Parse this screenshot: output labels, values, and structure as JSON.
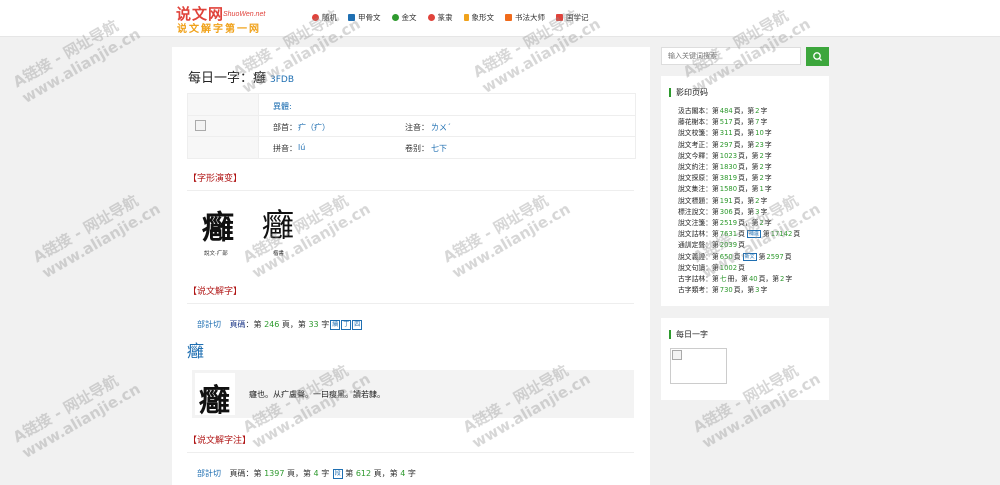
{
  "logo": {
    "main": "说文网",
    "domain": "ShuoWen.net",
    "sub": "说文解字第一网"
  },
  "nav": [
    {
      "label": "随机",
      "icon": "plus-circle-icon",
      "color": "#e0433b"
    },
    {
      "label": "甲骨文",
      "icon": "bone-icon",
      "color": "#1f6fb2"
    },
    {
      "label": "金文",
      "icon": "gear-icon",
      "color": "#2e9a2e"
    },
    {
      "label": "篆隶",
      "icon": "gear-icon",
      "color": "#e0433b"
    },
    {
      "label": "象形文",
      "icon": "brush-icon",
      "color": "#f0a21b"
    },
    {
      "label": "书法大师",
      "icon": "grid-icon",
      "color": "#f06b1b"
    },
    {
      "label": "国学记",
      "icon": "grid-icon",
      "color": "#e0433b"
    }
  ],
  "entry": {
    "heading": "每日一字：",
    "char": "癰",
    "code": "3FDB",
    "yiti_label": "異體:",
    "radical_label": "部首：",
    "radical_value": "疒（疒）",
    "zhuyin_label": "注音：",
    "zhuyin_value": "ㄌㄨˊ",
    "pinyin_label": "拼音：",
    "pinyin_value": "lú",
    "volume_label": "卷别：",
    "volume_value": "七下"
  },
  "sections": {
    "evolution": "【字形演变】",
    "shuowen": "【说文解字】",
    "shuowen_note": "【说文解字注】"
  },
  "evolution_captions": [
    "說文·疒部",
    "楷書"
  ],
  "shuowen_line": {
    "fanqie": "部計切",
    "page_label": "頁碼",
    "text_a": "：第",
    "page": "246",
    "text_b": "頁，第",
    "index": "33",
    "text_c": "字",
    "boxes": [
      "續",
      "丁",
      "四"
    ]
  },
  "def_char": "癰",
  "definition": "癰也。从疒盧聲。一曰瘦黑。讀若隸。",
  "note_line": {
    "fanqie": "部計切",
    "page_label": "頁碼",
    "text_a": "：第",
    "page": "1397",
    "text_b": "頁，第",
    "index": "4",
    "text_c": "字",
    "box": "段",
    "text_d": "第",
    "page2": "612",
    "text_e": "頁，第",
    "index2": "4",
    "text_f": "字"
  },
  "search": {
    "placeholder": "输入关键词搜索"
  },
  "page_panel": {
    "title": "影印页码",
    "rows": [
      {
        "name": "汲古閣本",
        "a": "第",
        "p1": "484",
        "b": "頁，第",
        "p2": "2",
        "c": "字"
      },
      {
        "name": "藤花榭本",
        "a": "第",
        "p1": "517",
        "b": "頁，第",
        "p2": "7",
        "c": "字"
      },
      {
        "name": "說文校箋",
        "a": "第",
        "p1": "311",
        "b": "頁，第",
        "p2": "10",
        "c": "字"
      },
      {
        "name": "說文考正",
        "a": "第",
        "p1": "297",
        "b": "頁，第",
        "p2": "23",
        "c": "字"
      },
      {
        "name": "說文今釋",
        "a": "第",
        "p1": "1023",
        "b": "頁，第",
        "p2": "2",
        "c": "字"
      },
      {
        "name": "說文約注",
        "a": "第",
        "p1": "1830",
        "b": "頁，第",
        "p2": "2",
        "c": "字"
      },
      {
        "name": "說文探原",
        "a": "第",
        "p1": "3819",
        "b": "頁，第",
        "p2": "2",
        "c": "字"
      },
      {
        "name": "說文集注",
        "a": "第",
        "p1": "1580",
        "b": "頁，第",
        "p2": "1",
        "c": "字"
      },
      {
        "name": "說文標題",
        "a": "第",
        "p1": "191",
        "b": "頁，第",
        "p2": "2",
        "c": "字"
      },
      {
        "name": "標注說文",
        "a": "第",
        "p1": "306",
        "b": "頁，第",
        "p2": "3",
        "c": "字"
      },
      {
        "name": "說文注箋",
        "a": "第",
        "p1": "2519",
        "b": "頁，第",
        "p2": "2",
        "c": "字"
      },
      {
        "name": "說文詁林",
        "a": "第",
        "p1": "7631",
        "b": "頁",
        "tag": "補遺",
        "b2": "第",
        "p3": "17142",
        "c": "頁"
      },
      {
        "name": "通訓定聲",
        "a": "第",
        "p1": "2039",
        "b": "頁"
      },
      {
        "name": "說文義證",
        "a": "第",
        "p1": "650",
        "b": "頁",
        "tag": "新文",
        "b2": "第",
        "p3": "2597",
        "c": "頁"
      },
      {
        "name": "說文句讀",
        "a": "第",
        "p1": "1002",
        "b": "頁"
      },
      {
        "name": "古字詁林",
        "a": "第",
        "p1": "七",
        "b": "冊，第",
        "p2": "40",
        "c": "頁，第",
        "p4": "2",
        "d": "字"
      },
      {
        "name": "古字類考",
        "a": "第",
        "p1": "730",
        "b": "頁，第",
        "p2": "3",
        "c": "字"
      }
    ]
  },
  "daily_panel": {
    "title": "每日一字"
  },
  "watermark": {
    "line1": "A链接 - 网址导航",
    "line2": "www.alianjie.cn"
  }
}
